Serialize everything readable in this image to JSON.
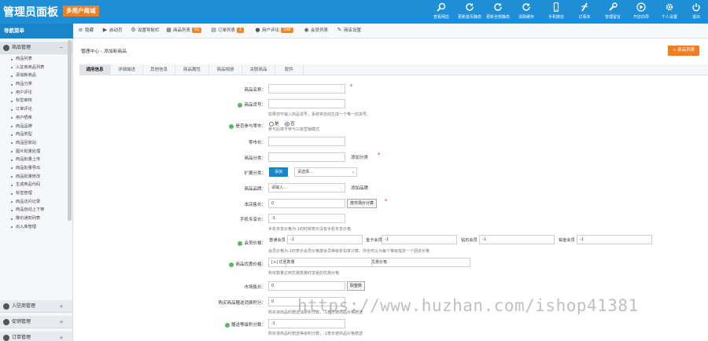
{
  "header": {
    "title": "管理员面板",
    "badge": "多用户商城",
    "nav": [
      {
        "label": "查看网店",
        "icon": "search-icon"
      },
      {
        "label": "更新首页静态",
        "icon": "refresh-icon"
      },
      {
        "label": "更新全部静态",
        "icon": "refresh-icon"
      },
      {
        "label": "清除缓存",
        "icon": "refresh-icon"
      },
      {
        "label": "手机微信",
        "icon": "mobile-icon"
      },
      {
        "label": "记事本",
        "icon": "notepad-icon"
      },
      {
        "label": "管理留言",
        "icon": "wrench-icon"
      },
      {
        "label": "开店向导",
        "icon": "play-circle-icon"
      },
      {
        "label": "个人设置",
        "icon": "gear-icon"
      },
      {
        "label": "退出",
        "icon": "power-icon"
      }
    ]
  },
  "navbar": {
    "menu_title": "导航菜单",
    "items": [
      {
        "label": "隐藏",
        "icon": "list-icon"
      },
      {
        "label": "启动页",
        "icon": "play-icon"
      },
      {
        "label": "设置导航栏",
        "icon": "gear-icon"
      },
      {
        "label": "商品列表",
        "icon": "grid-icon",
        "badge": "41"
      },
      {
        "label": "订单列表",
        "icon": "clipboard-icon",
        "badge": "2"
      },
      {
        "label": "用户评论",
        "icon": "users-icon",
        "badge": "348"
      },
      {
        "label": "会员列表",
        "icon": "user-icon"
      },
      {
        "label": "商店设置",
        "icon": "wrench-icon"
      }
    ]
  },
  "sidebar": {
    "sections": [
      {
        "label": "商品管理",
        "icon": "grid-icon"
      },
      {
        "label": "入驻商管理",
        "icon": "users-icon"
      },
      {
        "label": "促销管理",
        "icon": "tag-icon"
      },
      {
        "label": "订单管理",
        "icon": "clipboard-icon"
      }
    ],
    "items": [
      "商品列表",
      "入驻商商品列表",
      "添加新商品",
      "商品分类",
      "用户评论",
      "标签审核",
      "订单评论",
      "用户晒单",
      "商品品牌",
      "商品类型",
      "商品回收站",
      "图片批量处理",
      "商品批量上传",
      "商品批量导出",
      "商品批量修改",
      "生成商品代码",
      "标签管理",
      "商品访问记录",
      "商品自动上下架",
      "降价通知列表",
      "出入库管理"
    ]
  },
  "main": {
    "breadcrumb": "管理中心 - 添加新商品",
    "list_button": "+ 商品列表",
    "tabs": [
      "通用信息",
      "详细描述",
      "其他信息",
      "商品属性",
      "商品相册",
      "关联商品",
      "配件"
    ],
    "form": {
      "name_label": "商品名称：",
      "sn_label": "商品货号：",
      "sn_hint": "如果您不输入商品货号，系统将自动生成一个唯一的货号。",
      "distrib_label": "是否参与零市：",
      "radio_yes": "是",
      "radio_no": "否",
      "distrib_hint": "参与后将不参与三级营销模式",
      "market_label": "零市价：",
      "cat_label": "商品分类：",
      "add_cat": "添加分类",
      "ext_cat_label": "扩展分类：",
      "add_button": "添加",
      "ext_cat_select": "请选择...",
      "brand_label": "商品品牌：",
      "brand_placeholder": "请输入...",
      "add_brand": "添加品牌",
      "shop_price_label": "本店售价：",
      "shop_price_value": "0",
      "calc_button": "按市场价计算",
      "mobile_price_label": "手机专享价：",
      "mobile_price_value": "-1",
      "mobile_hint": "手机专享价格为-1的时候表示没有手机专享价格",
      "member_price_label": "会员价格：",
      "member_levels": [
        {
          "name": "普通会员",
          "value": "-1"
        },
        {
          "name": "金卡会员",
          "value": "-1"
        },
        {
          "name": "钻石会员",
          "value": "-1"
        },
        {
          "name": "铂金会员",
          "value": "-1"
        }
      ],
      "member_hint": "会员价格为-1时表示会员价格按会员等级折扣率计算。你也可以为每个等级指定一个固定价格",
      "promo_label": "商品优惠价格：",
      "promo_qty": "[+] 优惠数量",
      "promo_price": "优惠价格",
      "promo_hint": "购买数量达到优惠数量时享受的优惠价格",
      "mkt_price_label": "市场售价：",
      "mkt_price_value": "0",
      "round_button": "取整数",
      "give_points_label": "购买商品赠送消费积分：",
      "give_points_value": "0",
      "give_points_hint": "购买该商品时赠送消费积分数，-1表示按商品价格赠送",
      "rank_points_label": "赠送等级积分数：",
      "rank_points_value": "-1",
      "rank_points_hint": "购买该商品时赠送等级积分数，-1表示按商品价格赠送"
    }
  },
  "watermark": "https://www.huzhan.com/ishop41381"
}
